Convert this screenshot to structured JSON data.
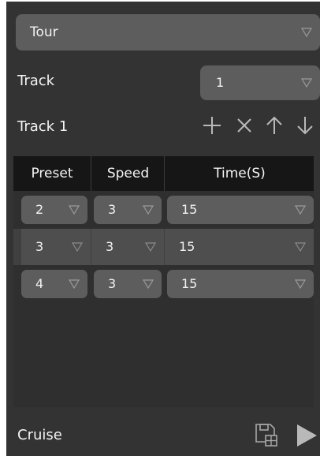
{
  "tour_select": {
    "value": "Tour"
  },
  "track_row": {
    "label": "Track",
    "select_value": "1"
  },
  "track_title": "Track 1",
  "toolbar": {
    "add_icon": "plus-icon",
    "delete_icon": "close-icon",
    "move_up_icon": "arrow-up-icon",
    "move_down_icon": "arrow-down-icon"
  },
  "table": {
    "columns": [
      "Preset",
      "Speed",
      "Time(S)"
    ],
    "rows": [
      {
        "preset": "2",
        "speed": "3",
        "time": "15"
      },
      {
        "preset": "3",
        "speed": "3",
        "time": "15"
      },
      {
        "preset": "4",
        "speed": "3",
        "time": "15"
      }
    ]
  },
  "footer": {
    "label": "Cruise",
    "save_icon": "save-icon",
    "play_icon": "play-icon"
  },
  "colors": {
    "panel_bg": "#333333",
    "control_bg": "#5d5d5d",
    "table_header_bg": "#161616",
    "text": "#f4f4f4"
  }
}
